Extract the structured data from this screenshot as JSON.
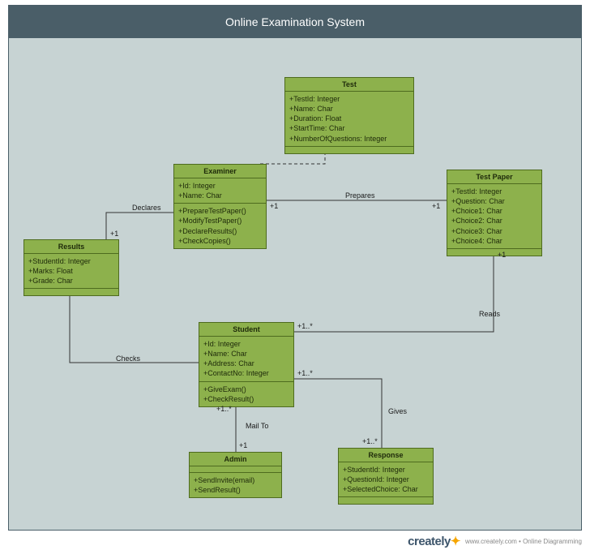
{
  "title": "Online Examination System",
  "classes": {
    "test": {
      "name": "Test",
      "attrs": [
        "+TestId: Integer",
        "+Name: Char",
        "+Duration: Float",
        "+StartTime: Char",
        "+NumberOfQuestions: Integer"
      ]
    },
    "examiner": {
      "name": "Examiner",
      "attrs": [
        "+Id: Integer",
        "+Name: Char"
      ],
      "ops": [
        "+PrepareTestPaper()",
        "+ModifyTestPaper()",
        "+DeclareResults()",
        "+CheckCopies()"
      ]
    },
    "testpaper": {
      "name": "Test Paper",
      "attrs": [
        "+TestId: Integer",
        "+Question: Char",
        "+Choice1: Char",
        "+Choice2: Char",
        "+Choice3: Char",
        "+Choice4: Char"
      ]
    },
    "results": {
      "name": "Results",
      "attrs": [
        "+StudentId: Integer",
        "+Marks: Float",
        "+Grade: Char"
      ]
    },
    "student": {
      "name": "Student",
      "attrs": [
        "+Id: Integer",
        "+Name: Char",
        "+Address: Char",
        "+ContactNo: Integer"
      ],
      "ops": [
        "+GiveExam()",
        "+CheckResult()"
      ]
    },
    "admin": {
      "name": "Admin",
      "ops": [
        "+SendInvite(email)",
        "+SendResult()"
      ]
    },
    "response": {
      "name": "Response",
      "attrs": [
        "+StudentId: Integer",
        "+QuestionId: Integer",
        "+SelectedChoice: Char"
      ]
    }
  },
  "edges": {
    "declares": {
      "label": "Declares",
      "m1": "+1",
      "m2": ""
    },
    "prepares": {
      "label": "Prepares",
      "m1": "+1",
      "m2": "+1"
    },
    "reads": {
      "label": "Reads",
      "m1": "+1..*",
      "m2": "+1"
    },
    "checks": {
      "label": "Checks",
      "m1": "",
      "m2": ""
    },
    "mailto": {
      "label": "Mail To",
      "m1": "+1..*",
      "m2": "+1"
    },
    "gives": {
      "label": "Gives",
      "m1": "+1..*",
      "m2": "+1..*"
    }
  },
  "footer": {
    "brand": "creately",
    "tag": "www.creately.com • Online Diagramming"
  }
}
